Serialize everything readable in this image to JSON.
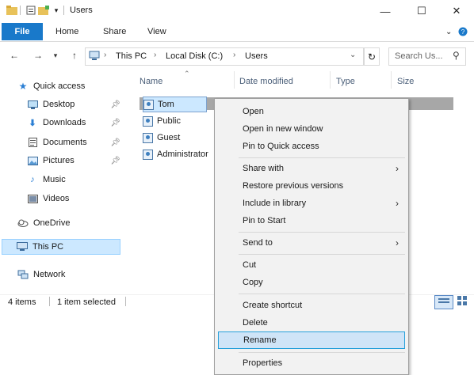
{
  "window": {
    "title": "Users",
    "controls": {
      "minimize": "—",
      "maximize": "☐",
      "close": "✕"
    }
  },
  "ribbon": {
    "tabs": [
      "File",
      "Home",
      "Share",
      "View"
    ],
    "collapse_icon": "chevron-down-icon",
    "help_icon": "help-icon"
  },
  "address": {
    "path": [
      "This PC",
      "Local Disk (C:)",
      "Users"
    ],
    "search_placeholder": "Search Us..."
  },
  "nav": {
    "quick_access": "Quick access",
    "quick_items": [
      {
        "label": "Desktop",
        "icon": "desktop-icon"
      },
      {
        "label": "Downloads",
        "icon": "downloads-icon"
      },
      {
        "label": "Documents",
        "icon": "documents-icon"
      },
      {
        "label": "Pictures",
        "icon": "pictures-icon"
      },
      {
        "label": "Music",
        "icon": "music-icon"
      },
      {
        "label": "Videos",
        "icon": "videos-icon"
      }
    ],
    "onedrive": "OneDrive",
    "thispc": "This PC",
    "network": "Network"
  },
  "filelist": {
    "columns": [
      "Name",
      "Date modified",
      "Type",
      "Size"
    ],
    "items": [
      "Tom",
      "Public",
      "Guest",
      "Administrator"
    ]
  },
  "status": {
    "count": "4 items",
    "selected": "1 item selected"
  },
  "context_menu": {
    "items": [
      "Open",
      "Open in new window",
      "Pin to Quick access",
      "Share with",
      "Restore previous versions",
      "Include in library",
      "Pin to Start",
      "Send to",
      "Cut",
      "Copy",
      "Create shortcut",
      "Delete",
      "Rename",
      "Properties"
    ]
  },
  "colors": {
    "file_tab": "#1979ca",
    "selection": "#cce8ff",
    "menu_bg": "#f2f2f2",
    "menu_highlight_border": "#26a0da"
  }
}
